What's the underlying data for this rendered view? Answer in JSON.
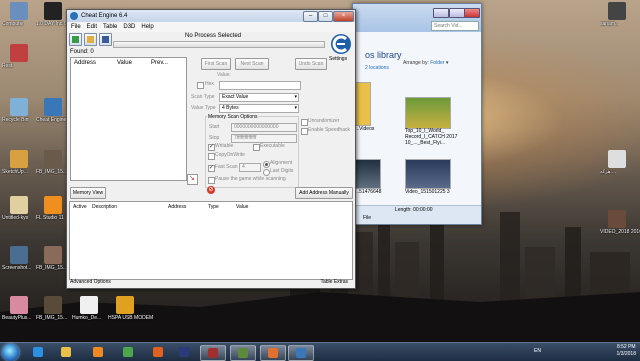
{
  "desktop": {
    "icons_left": [
      {
        "label": "Computer",
        "color": "#6a8fbf"
      },
      {
        "label": "1.0 DAY Inc.Cli...",
        "color": "#222"
      },
      {
        "label": "Rest.",
        "color": "#c04040"
      },
      {
        "label": "Recycle Bin",
        "color": "#7fb0d8"
      },
      {
        "label": "Cheat Engine",
        "color": "#3a77b8"
      },
      {
        "label": "SketchUp...",
        "color": "#d8a040"
      },
      {
        "label": "FB_IMG_15...",
        "color": "#6a5a4a"
      },
      {
        "label": "Untitled-kys",
        "color": "#e0d0a0"
      },
      {
        "label": "FL Studio 11",
        "color": "#ef8f20"
      },
      {
        "label": "Screenshot...",
        "color": "#4b6d92"
      },
      {
        "label": "FB_IMG_15...",
        "color": "#8a6a5a"
      },
      {
        "label": "BeautyPlus...",
        "color": "#d98aa0"
      },
      {
        "label": "FB_IMG_15...",
        "color": "#5a4a3a"
      },
      {
        "label": "Humko_De...",
        "color": "#f0f0f0"
      },
      {
        "label": "HSPA USB MODEM",
        "color": "#e0a020"
      }
    ],
    "icons_right": [
      {
        "label": "sanam...",
        "color": "#444"
      },
      {
        "label": "هرکه ...",
        "color": "#dedede"
      },
      {
        "label": "VIDEO_2018 2016-12-...",
        "color": "#6a4a3a"
      }
    ]
  },
  "explorer": {
    "search_placeholder": "Search Vid...",
    "library_title": "os library",
    "library_sub": "2 locations",
    "arrange_label": "Arrange by:",
    "arrange_value": "Folder",
    "items": [
      {
        "label": "...Videos"
      },
      {
        "label": "Top_10_I_World_ Record_I_CATCH 2017 10_..._Best_Flyi..."
      },
      {
        "label": "...51476648"
      },
      {
        "label": "Video_151501225 3"
      }
    ],
    "status_length": "Length: 00:00:00",
    "status_type": "File"
  },
  "ce": {
    "title": "Cheat Engine 6.4",
    "menu": [
      "File",
      "Edit",
      "Table",
      "D3D",
      "Help"
    ],
    "process": "No Process Selected",
    "found": "Found: 0",
    "columns": [
      "Address",
      "Value",
      "Prev..."
    ],
    "logo_label": "Settings",
    "first_scan": "First Scan",
    "next_scan": "Next Scan",
    "undo_scan": "Undo Scan",
    "value_label": "Value:",
    "hex_label": "Hex",
    "scan_type_label": "Scan Type",
    "scan_type_value": "Exact Value",
    "value_type_label": "Value Type",
    "value_type_value": "4 Bytes",
    "mem_options": "Memory Scan Options",
    "start_label": "Start",
    "start_value": "0000000000000000",
    "stop_label": "Stop",
    "stop_value": "7fffffffffffffff",
    "writable": "Writable",
    "executable": "Executable",
    "copyonwrite": "CopyOnWrite",
    "fastscan": "Fast Scan",
    "fastscan_value": "4",
    "alignment": "Alignment",
    "lastdigits": "Last Digits",
    "pause": "Pause the game while scanning",
    "unrandomizer": "Unrandomizer",
    "speedhack": "Enable Speedhack",
    "memory_view": "Memory View",
    "add_address": "Add Address Manually",
    "table_columns": [
      "Active",
      "Description",
      "Address",
      "Type",
      "Value"
    ],
    "advanced": "Advanced Options",
    "table_extras": "Table Extras"
  },
  "taskbar": {
    "language": "EN",
    "time": "8:52 PM",
    "date": "1/3/2018",
    "apps": [
      {
        "name": "ie",
        "color": "#2d8fe0"
      },
      {
        "name": "folder",
        "color": "#e8c04a"
      },
      {
        "name": "media",
        "color": "#f08a20"
      },
      {
        "name": "chrome",
        "color": "#4aa84a"
      },
      {
        "name": "firefox",
        "color": "#e06020"
      },
      {
        "name": "ps",
        "color": "#2a3a7a"
      },
      {
        "name": "game",
        "color": "#a03030"
      },
      {
        "name": "green",
        "color": "#5a8a3a"
      },
      {
        "name": "orange",
        "color": "#e07030"
      },
      {
        "name": "cheat",
        "color": "#3a77b8"
      }
    ]
  }
}
